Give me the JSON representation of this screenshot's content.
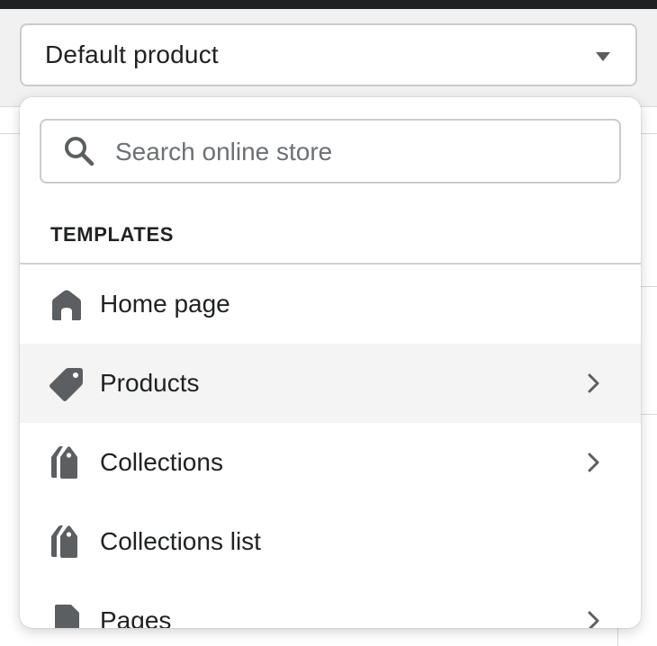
{
  "template_selector": {
    "selected_label": "Default product",
    "caret_icon": "caret-down-icon"
  },
  "dropdown": {
    "search": {
      "placeholder": "Search online store",
      "value": "",
      "icon": "search-icon"
    },
    "section_heading": "TEMPLATES",
    "items": [
      {
        "label": "Home page",
        "icon": "home-icon",
        "has_submenu": false,
        "selected": false
      },
      {
        "label": "Products",
        "icon": "tag-icon",
        "has_submenu": true,
        "selected": true
      },
      {
        "label": "Collections",
        "icon": "collections-icon",
        "has_submenu": true,
        "selected": false
      },
      {
        "label": "Collections list",
        "icon": "collections-icon",
        "has_submenu": false,
        "selected": false
      },
      {
        "label": "Pages",
        "icon": "page-icon",
        "has_submenu": true,
        "selected": false
      }
    ]
  },
  "colors": {
    "icon": "#5c5f62",
    "hover_row": "#f4f4f4",
    "border": "#c9cccf"
  }
}
